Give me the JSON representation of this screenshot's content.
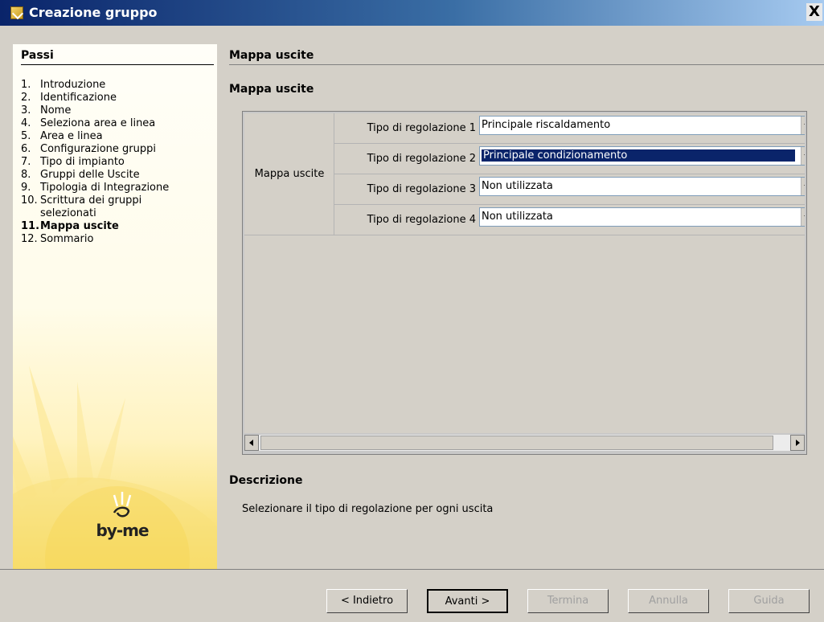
{
  "window": {
    "title": "Creazione gruppo",
    "close_label": "X"
  },
  "sidebar": {
    "heading": "Passi",
    "steps": [
      {
        "num": "1.",
        "label": "Introduzione"
      },
      {
        "num": "2.",
        "label": "Identificazione"
      },
      {
        "num": "3.",
        "label": "Nome"
      },
      {
        "num": "4.",
        "label": "Seleziona area e linea"
      },
      {
        "num": "5.",
        "label": "Area e linea"
      },
      {
        "num": "6.",
        "label": "Configurazione gruppi"
      },
      {
        "num": "7.",
        "label": "Tipo di impianto"
      },
      {
        "num": "8.",
        "label": "Gruppi delle Uscite"
      },
      {
        "num": "9.",
        "label": "Tipologia di Integrazione"
      },
      {
        "num": "10.",
        "label": "Scrittura dei gruppi"
      },
      {
        "num": "",
        "label": "selezionati"
      },
      {
        "num": "11.",
        "label": "Mappa uscite"
      },
      {
        "num": "12.",
        "label": "Sommario"
      }
    ],
    "logo_text": "by-me"
  },
  "main": {
    "header": "Mappa uscite",
    "subheader": "Mappa uscite",
    "group_label": "Mappa uscite",
    "rows": [
      {
        "label": "Tipo di regolazione 1",
        "value": "Principale riscaldamento"
      },
      {
        "label": "Tipo di regolazione 2",
        "value": "Principale condizionamento"
      },
      {
        "label": "Tipo di regolazione 3",
        "value": "Non utilizzata"
      },
      {
        "label": "Tipo di regolazione 4",
        "value": "Non utilizzata"
      }
    ],
    "description_heading": "Descrizione",
    "description_text": "Selezionare il tipo di regolazione per ogni uscita"
  },
  "footer": {
    "back": "< Indietro",
    "next": "Avanti >",
    "finish": "Termina",
    "cancel": "Annulla",
    "help": "Guida"
  },
  "colors": {
    "selection": "#0a246a",
    "title_bar": "#0a246a",
    "sidebar_accent": "#f7d95a"
  }
}
